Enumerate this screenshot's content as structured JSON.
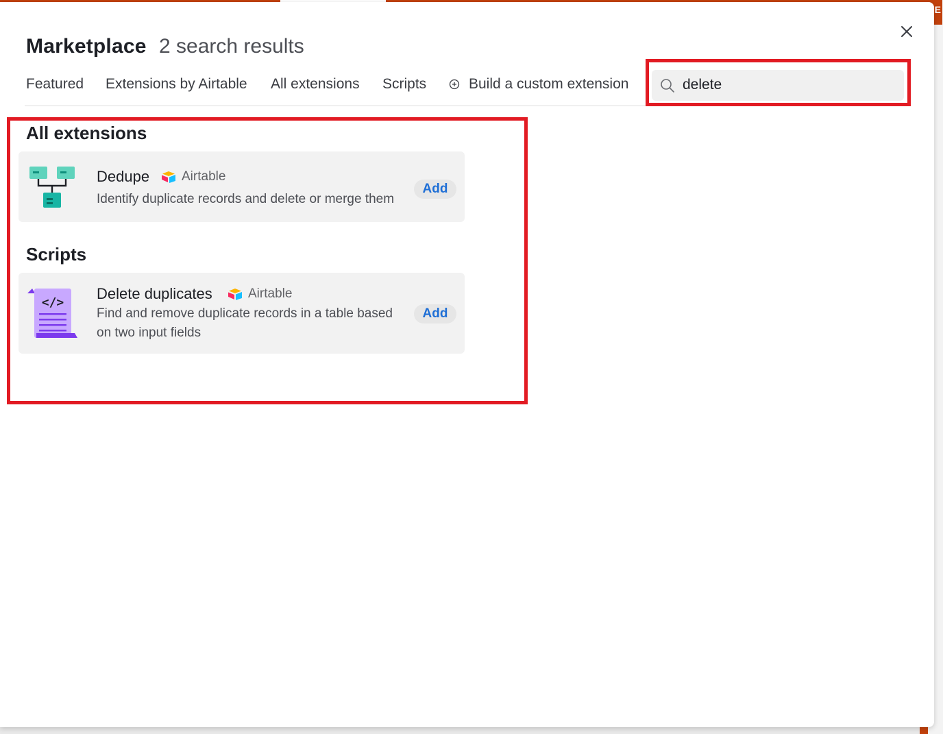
{
  "header": {
    "title": "Marketplace",
    "subtitle": "2 search results"
  },
  "tabs": [
    {
      "label": "Featured"
    },
    {
      "label": "Extensions by Airtable"
    },
    {
      "label": "All extensions"
    },
    {
      "label": "Scripts"
    },
    {
      "label": "Build a custom extension",
      "icon": "plus-circle-icon"
    }
  ],
  "search": {
    "value": "delete",
    "icon": "search-icon"
  },
  "sections": [
    {
      "title": "All extensions",
      "items": [
        {
          "name": "Dedupe",
          "publisher": "Airtable",
          "description": "Identify duplicate records and delete or merge them",
          "action": "Add",
          "icon": "dedupe-icon"
        }
      ]
    },
    {
      "title": "Scripts",
      "items": [
        {
          "name": "Delete duplicates",
          "publisher": "Airtable",
          "description": "Find and remove duplicate records in a table based on two input fields",
          "action": "Add",
          "icon": "script-scroll-icon"
        }
      ]
    }
  ],
  "background": {
    "corner_label": "E"
  },
  "colors": {
    "highlight": "#e21b23",
    "accent": "#1f6fd6",
    "app_bar": "#c2410c",
    "card": "#f2f2f2"
  }
}
